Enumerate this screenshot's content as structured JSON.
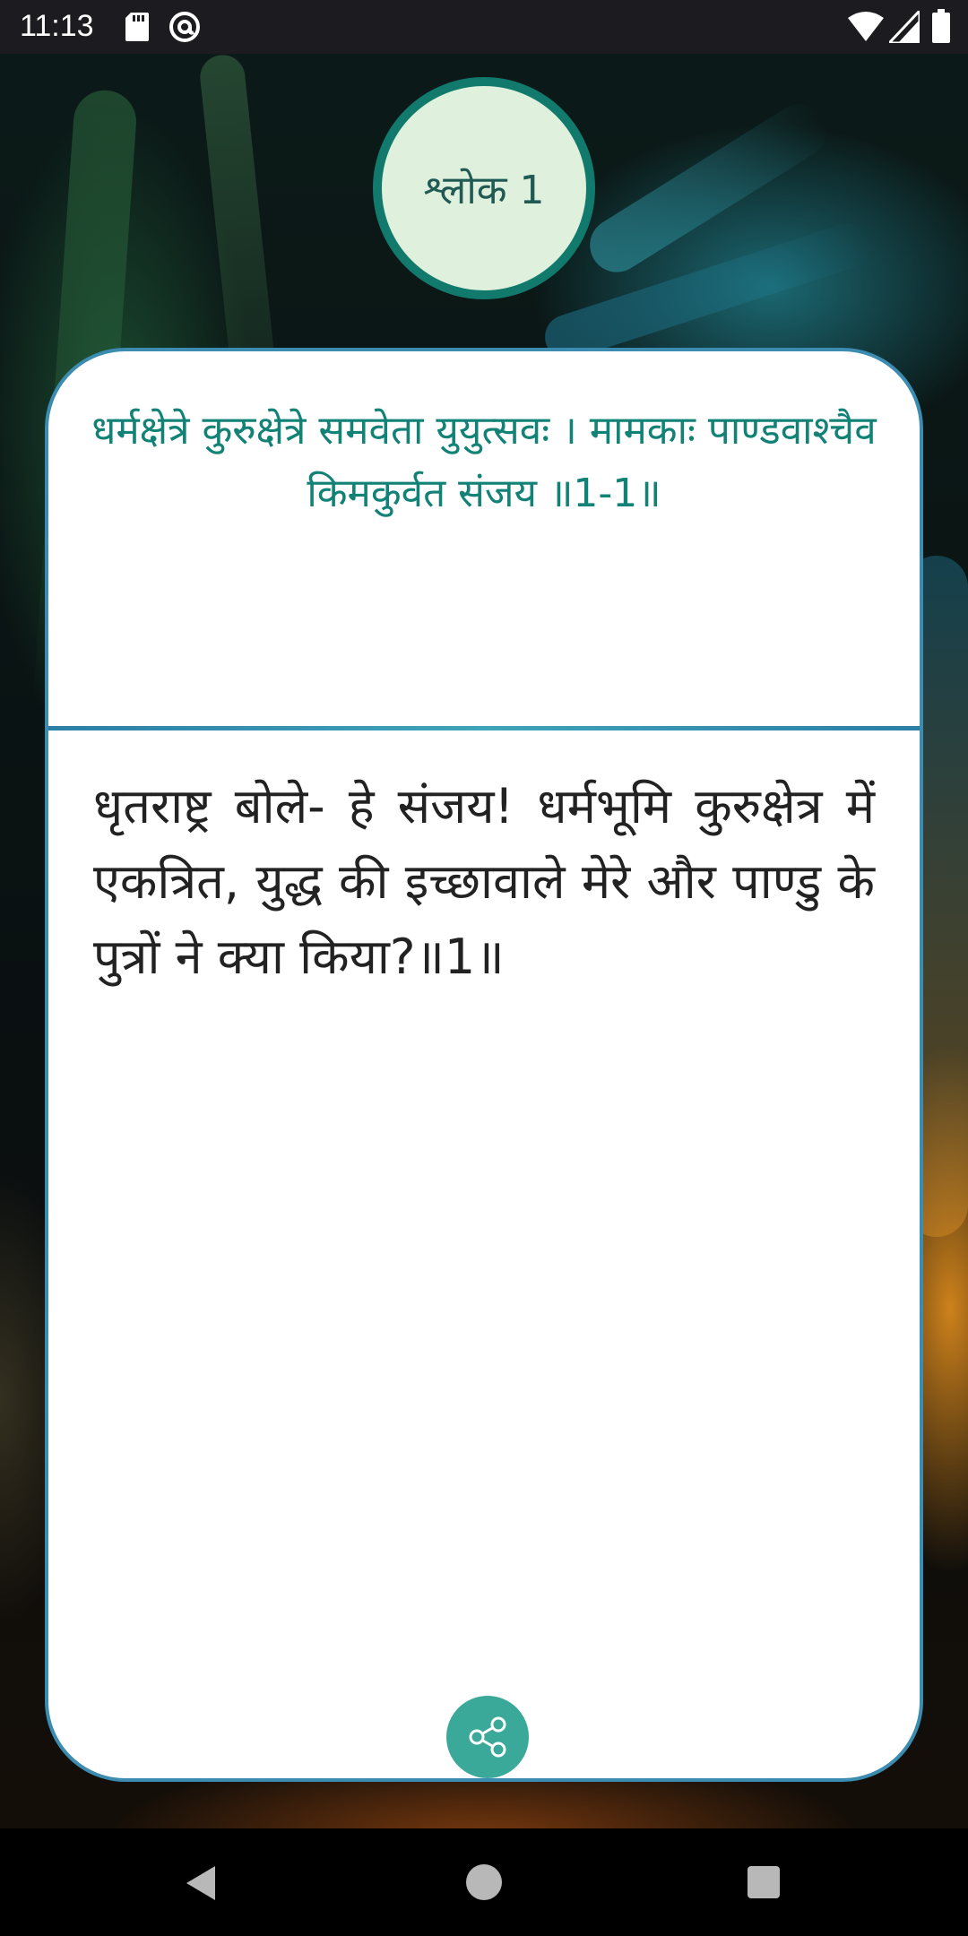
{
  "status_bar": {
    "time": "11:13",
    "icons": [
      "sd-card-icon",
      "at-sign-icon",
      "wifi-icon",
      "signal-icon",
      "battery-icon"
    ]
  },
  "badge": {
    "label": "श्लोक 1"
  },
  "verse": {
    "sanskrit": "धर्मक्षेत्रे कुरुक्षेत्रे समवेता युयुत्सवः । मामकाः पाण्डवाश्चैव किमकुर्वत संजय ॥1-1॥"
  },
  "translation": {
    "hindi": "धृतराष्ट्र बोले- हे संजय! धर्मभूमि कुरुक्षेत्र में एकत्रित, युद्ध की इच्छावाले मेरे और पाण्डु के पुत्रों ने क्या किया?॥1॥"
  },
  "actions": {
    "share_icon": "share-icon"
  },
  "nav_bar": {
    "icons": [
      "back-icon",
      "home-icon",
      "recents-icon"
    ]
  },
  "colors": {
    "accent": "#118275",
    "badge_fill": "#dff0dc",
    "badge_border": "#117a6d",
    "share_button": "#3aa99a",
    "card_border": "#3b8cb0"
  }
}
